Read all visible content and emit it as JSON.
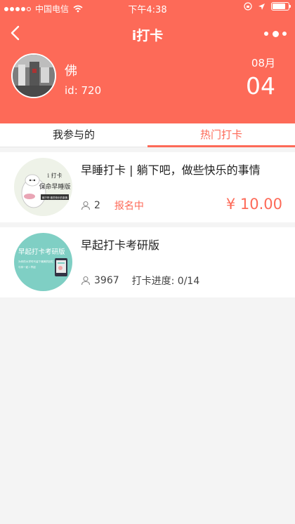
{
  "status_bar": {
    "carrier": "中国电信",
    "time": "下午4:38"
  },
  "nav": {
    "title": "i打卡"
  },
  "profile": {
    "name": "佛",
    "id_text": "id: 720"
  },
  "date": {
    "month": "08月",
    "day": "04"
  },
  "tabs": [
    {
      "label": "我参与的",
      "active": false
    },
    {
      "label": "热门打卡",
      "active": true
    }
  ],
  "cards": [
    {
      "title": "早睡打卡 | 躺下吧，做些快乐的事情",
      "participants": "2",
      "status": "报名中",
      "price": "¥ 10.00",
      "thumb": {
        "line1": "i 打卡",
        "line2": "保命早睡版",
        "line3": "躺下吧 做些快乐的事情"
      }
    },
    {
      "title": "早起打卡考研版",
      "participants": "3967",
      "progress": "打卡进度: 0/14",
      "thumb": {
        "line1": "早起打卡考研版",
        "line2": "为你的大学时代留下最美的回忆",
        "line3": "与你一起 i 早起"
      }
    }
  ],
  "colors": {
    "accent": "#fd6a58",
    "background": "#f4f4f4"
  },
  "icons": [
    "back-icon",
    "more-icon",
    "wifi-icon",
    "location-icon",
    "battery-icon",
    "person-icon"
  ]
}
